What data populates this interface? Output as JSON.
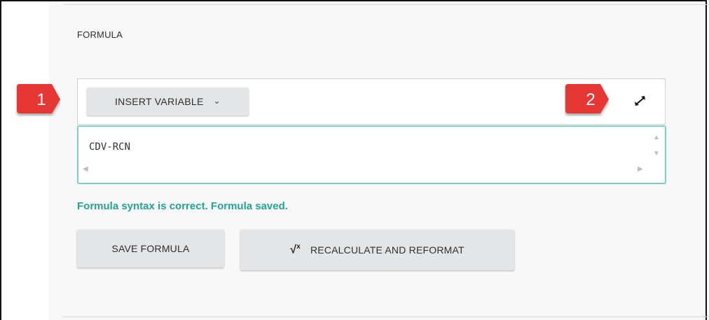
{
  "section": {
    "title": "FORMULA"
  },
  "toolbar": {
    "insert_variable_label": "INSERT VARIABLE",
    "insert_variable_chevron": "⌄",
    "expand_icon": "expand-arrows-icon"
  },
  "editor": {
    "formula": "CDV-RCN",
    "border_color": "#7bd0c2"
  },
  "status": {
    "message": "Formula syntax is correct. Formula saved.",
    "color": "#24a396"
  },
  "actions": {
    "save_label": "SAVE FORMULA",
    "recalc_label": "RECALCULATE AND REFORMAT",
    "recalc_icon_glyph": "√",
    "recalc_icon_sup": "x"
  },
  "callouts": [
    {
      "number": "1",
      "color": "#e53935"
    },
    {
      "number": "2",
      "color": "#e53935"
    }
  ]
}
